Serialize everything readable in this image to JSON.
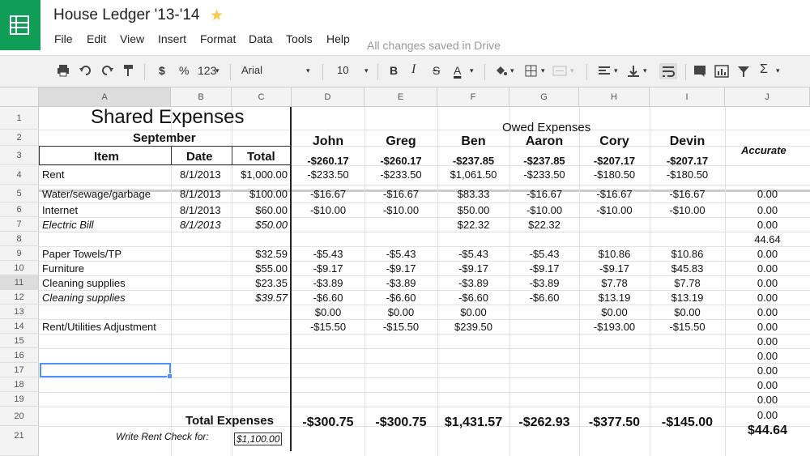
{
  "app": {
    "title": "House Ledger '13-'14",
    "star": "★",
    "menu": [
      "File",
      "Edit",
      "View",
      "Insert",
      "Format",
      "Data",
      "Tools",
      "Help"
    ],
    "saved_status": "All changes saved in Drive"
  },
  "toolbar": {
    "print_icon": "print-icon",
    "undo_icon": "undo-icon",
    "redo_icon": "redo-icon",
    "paint_icon": "paint-format-icon",
    "currency": "$",
    "percent": "%",
    "number_format": "123",
    "font": "Arial",
    "font_size": "10",
    "bold": "B",
    "italic": "I",
    "strike": "S",
    "text_color": "A",
    "sigma": "Σ"
  },
  "grid": {
    "columns": [
      "A",
      "B",
      "C",
      "D",
      "E",
      "F",
      "G",
      "H",
      "I",
      "J"
    ],
    "rows": [
      "1",
      "2",
      "3",
      "4",
      "5",
      "6",
      "7",
      "8",
      "9",
      "10",
      "11",
      "12",
      "13",
      "14",
      "15",
      "16",
      "17",
      "18",
      "19",
      "20",
      "21"
    ],
    "shared_title": "Shared Expenses",
    "month": "September",
    "headers": {
      "item": "Item",
      "date": "Date",
      "total": "Total"
    },
    "owed_title": "Owed Expenses",
    "people": [
      "John",
      "Greg",
      "Ben",
      "Aaron",
      "Cory",
      "Devin"
    ],
    "accurate": "Accurate",
    "row3": [
      "-$260.17",
      "-$260.17",
      "-$237.85",
      "-$237.85",
      "-$207.17",
      "-$207.17"
    ],
    "items": [
      {
        "item": "Rent",
        "date": "8/1/2013",
        "total": "$1,000.00",
        "owed": [
          "-$233.50",
          "-$233.50",
          "$1,061.50",
          "-$233.50",
          "-$180.50",
          "-$180.50"
        ],
        "acc": ""
      },
      {
        "item": "Water/sewage/garbage",
        "date": "8/1/2013",
        "total": "$100.00",
        "owed": [
          "-$16.67",
          "-$16.67",
          "$83.33",
          "-$16.67",
          "-$16.67",
          "-$16.67"
        ],
        "acc": "0.00"
      },
      {
        "item": "Internet",
        "date": "8/1/2013",
        "total": "$60.00",
        "owed": [
          "-$10.00",
          "-$10.00",
          "$50.00",
          "-$10.00",
          "-$10.00",
          "-$10.00"
        ],
        "acc": "0.00"
      },
      {
        "item": "Electric Bill",
        "date": "8/1/2013",
        "total": "$50.00",
        "owed": [
          "",
          "",
          "$22.32",
          "$22.32",
          "",
          ""
        ],
        "acc": "0.00"
      },
      {
        "item": "",
        "date": "",
        "total": "",
        "owed": [
          "",
          "",
          "",
          "",
          "",
          ""
        ],
        "acc": "44.64"
      },
      {
        "item": "Paper Towels/TP",
        "date": "",
        "total": "$32.59",
        "owed": [
          "-$5.43",
          "-$5.43",
          "-$5.43",
          "-$5.43",
          "$10.86",
          "$10.86"
        ],
        "acc": "0.00"
      },
      {
        "item": "Furniture",
        "date": "",
        "total": "$55.00",
        "owed": [
          "-$9.17",
          "-$9.17",
          "-$9.17",
          "-$9.17",
          "-$9.17",
          "$45.83"
        ],
        "acc": "0.00"
      },
      {
        "item": "Cleaning supplies",
        "date": "",
        "total": "$23.35",
        "owed": [
          "-$3.89",
          "-$3.89",
          "-$3.89",
          "-$3.89",
          "$7.78",
          "$7.78"
        ],
        "acc": "0.00"
      },
      {
        "item": "Cleaning supplies",
        "date": "",
        "total": "$39.57",
        "owed": [
          "-$6.60",
          "-$6.60",
          "-$6.60",
          "-$6.60",
          "$13.19",
          "$13.19"
        ],
        "acc": "0.00"
      },
      {
        "item": "",
        "date": "",
        "total": "",
        "owed": [
          "$0.00",
          "$0.00",
          "$0.00",
          "",
          "$0.00",
          "$0.00"
        ],
        "acc": "0.00"
      },
      {
        "item": "Rent/Utilities Adjustment",
        "date": "",
        "total": "",
        "owed": [
          "-$15.50",
          "-$15.50",
          "$239.50",
          "",
          "-$193.00",
          "-$15.50"
        ],
        "acc": "0.00"
      }
    ],
    "extra_acc": [
      "0.00",
      "0.00",
      "0.00",
      "0.00",
      "0.00"
    ],
    "total_label": "Total Expenses",
    "totals": [
      "-$300.75",
      "-$300.75",
      "$1,431.57",
      "-$262.93",
      "-$377.50",
      "-$145.00"
    ],
    "total_acc": "$44.64",
    "row20_acc": "0.00",
    "rent_check_label": "Write Rent Check for:",
    "rent_check_value": "$1,100.00"
  }
}
